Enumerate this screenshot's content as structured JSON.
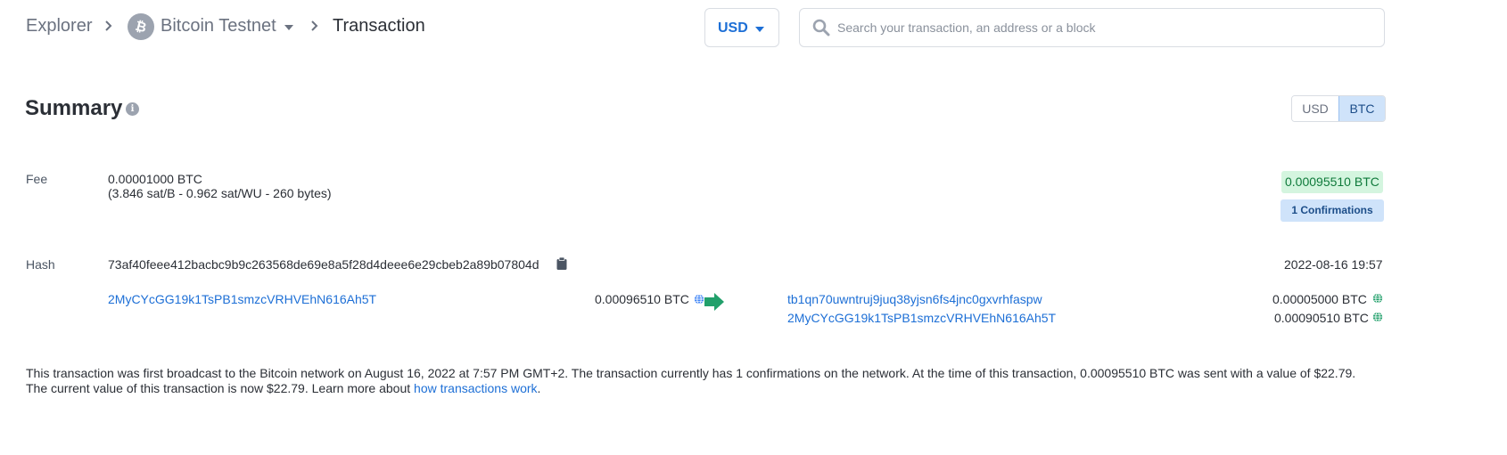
{
  "breadcrumb": {
    "explorer": "Explorer",
    "network": "Bitcoin Testnet",
    "current": "Transaction"
  },
  "currency_select": {
    "value": "USD"
  },
  "search": {
    "placeholder": "Search your transaction, an address or a block"
  },
  "summary": {
    "title": "Summary",
    "toggle": [
      "USD",
      "BTC"
    ],
    "toggle_selected": "BTC"
  },
  "fee": {
    "label": "Fee",
    "amount": "0.00001000 BTC",
    "details": "(3.846 sat/B - 0.962 sat/WU - 260 bytes)"
  },
  "total_badge": "0.00095510 BTC",
  "confirmations_badge": "1 Confirmations",
  "hash": {
    "label": "Hash",
    "value": "73af40feee412bacbc9b9c263568de69e8a5f28d4deee6e29cbeb2a89b07804d",
    "timestamp": "2022-08-16 19:57"
  },
  "inputs": [
    {
      "address": "2MyCYcGG19k1TsPB1smzcVRHVEhN616Ah5T",
      "amount": "0.00096510 BTC"
    }
  ],
  "outputs": [
    {
      "address": "tb1qn70uwntruj9juq38yjsn6fs4jnc0gxvrhfaspw",
      "amount": "0.00005000 BTC"
    },
    {
      "address": "2MyCYcGG19k1TsPB1smzcVRHVEhN616Ah5T",
      "amount": "0.00090510 BTC"
    }
  ],
  "description": {
    "line1": "This transaction was first broadcast to the Bitcoin network on August 16, 2022 at 7:57 PM GMT+2.  The transaction currently has 1 confirmations on the network.  At the time of this transaction, 0.00095510 BTC was sent with a value of $22.79.",
    "line2_prefix": "The current value of this transaction is now $22.79.  Learn more about ",
    "line2_link": "how transactions work",
    "line2_suffix": "."
  },
  "colors": {
    "link": "#1d6fd6",
    "input_globe": "#3b82f6",
    "output_globe": "#22a06b",
    "arrow": "#22a06b"
  }
}
